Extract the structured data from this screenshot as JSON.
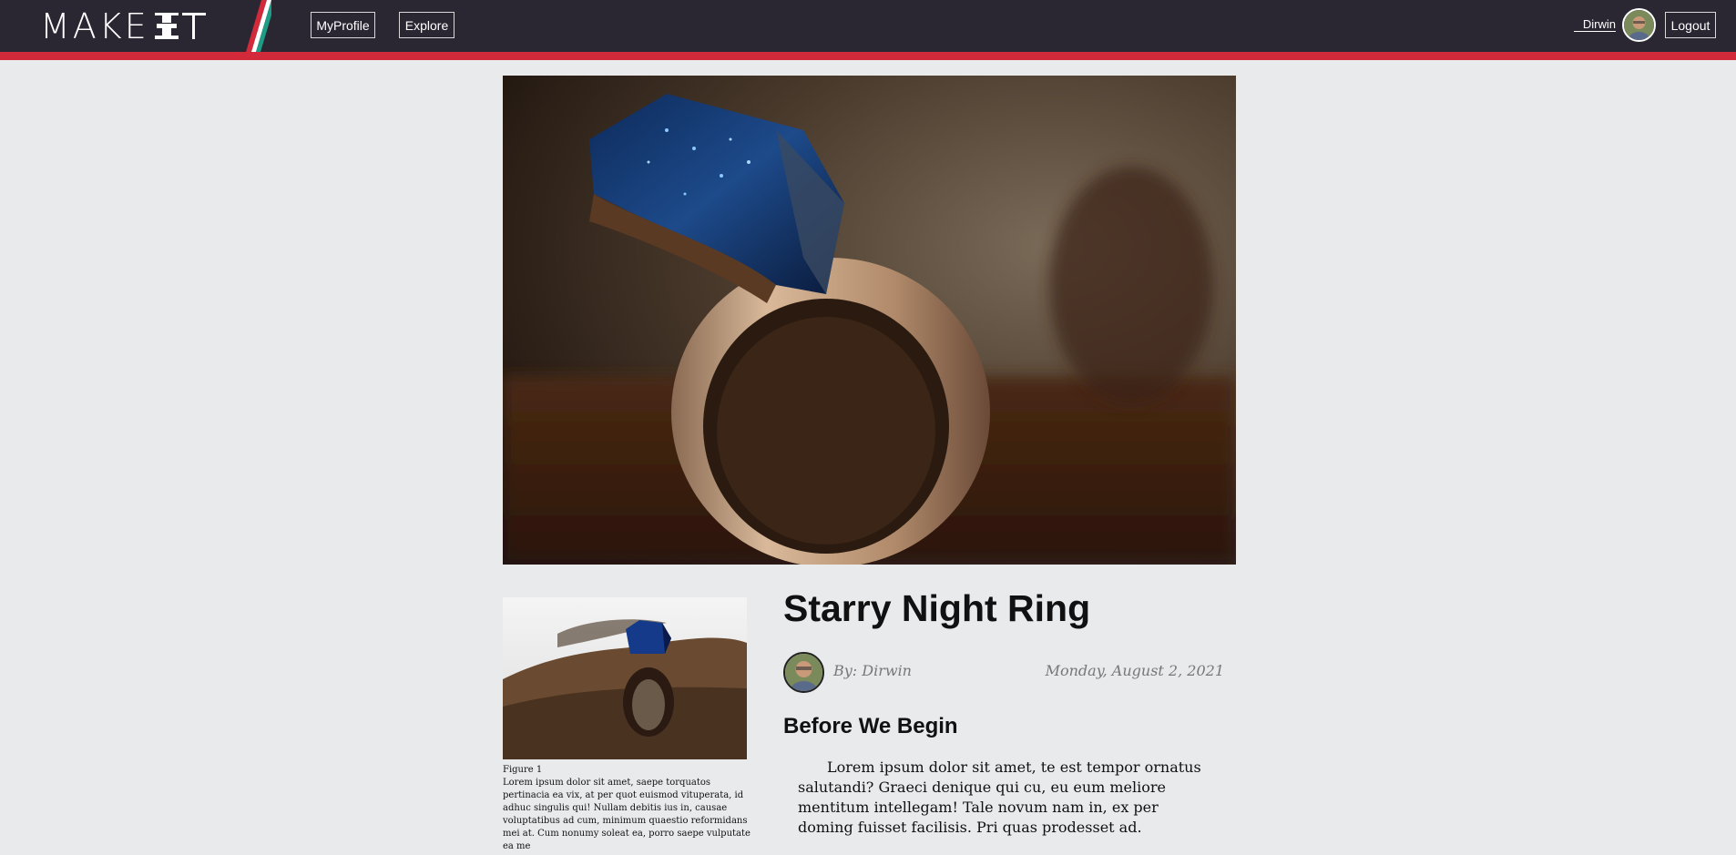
{
  "header": {
    "logo_text": "MAKE",
    "logo_alt": "MAKEIT",
    "nav": {
      "myprofile": "MyProfile",
      "explore": "Explore"
    },
    "user": {
      "name": "Dirwin",
      "logout": "Logout"
    },
    "colors": {
      "bar": "#2a2733",
      "accent": "#d22a3b"
    }
  },
  "hero": {
    "icon": "ring-photo"
  },
  "figure": {
    "caption_title": "Figure 1",
    "caption_text": "Lorem ipsum dolor sit amet, saepe torquatos pertinacia ea vix, at per quot euismod vituperata, id adhuc singulis qui! Nullam debitis ius in, causae voluptatibus ad cum, minimum quaestio reformidans mei at. Cum nonumy soleat ea, porro saepe vulputate ea me"
  },
  "article": {
    "title": "Starry Night Ring",
    "author": "By: Dirwin",
    "date": "Monday, August 2, 2021",
    "section_heading": "Before We Begin",
    "paragraph": "Lorem ipsum dolor sit amet, te est tempor ornatus salutandi? Graeci denique qui cu, eu eum meliore mentitum intellegam! Tale novum nam in, ex per doming fuisset facilisis. Pri quas prodesset ad."
  }
}
